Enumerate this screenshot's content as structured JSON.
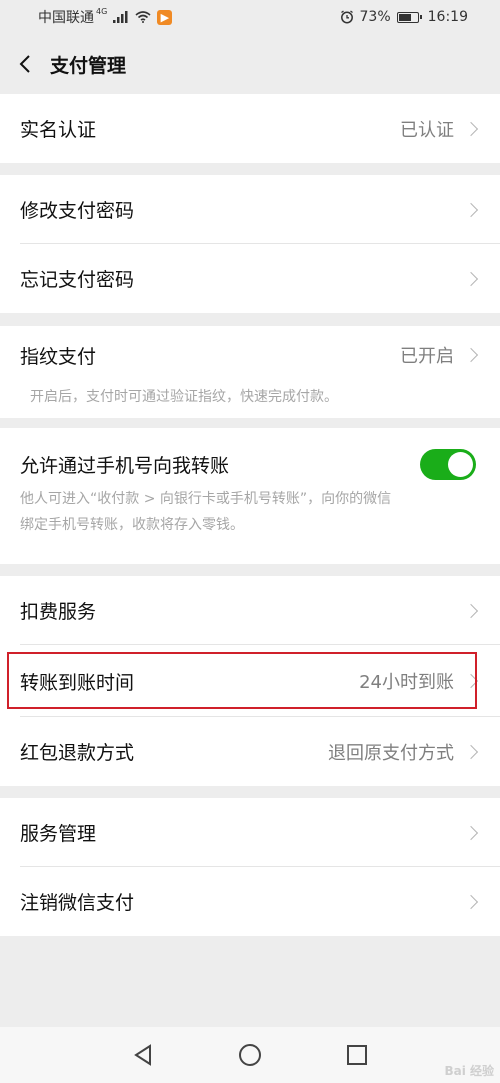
{
  "status_bar": {
    "carrier": "中国联通",
    "network": "4G",
    "battery_percent": "73%",
    "battery_level": 0.73,
    "time": "16:19"
  },
  "nav": {
    "title": "支付管理"
  },
  "groups": {
    "realname": {
      "label": "实名认证",
      "value": "已认证"
    },
    "change_password": {
      "label": "修改支付密码"
    },
    "forget_password": {
      "label": "忘记支付密码"
    },
    "fingerprint": {
      "label": "指纹支付",
      "value": "已开启",
      "desc": "开启后，支付时可通过验证指纹，快速完成付款。"
    },
    "phone_transfer": {
      "label": "允许通过手机号向我转账",
      "enabled": true,
      "desc_line1": "他人可进入“收付款 > 向银行卡或手机号转账”，向你的微信",
      "desc_line2": "绑定手机号转账，收款将存入零钱。"
    },
    "deduction": {
      "label": "扣费服务"
    },
    "transfer_time": {
      "label": "转账到账时间",
      "value": "24小时到账"
    },
    "redpacket_refund": {
      "label": "红包退款方式",
      "value": "退回原支付方式"
    },
    "service_manage": {
      "label": "服务管理"
    },
    "cancel_pay": {
      "label": "注销微信支付"
    }
  },
  "watermark": "Bai 经验",
  "colors": {
    "accent_green": "#1aad19",
    "highlight_red": "#d0202a"
  }
}
